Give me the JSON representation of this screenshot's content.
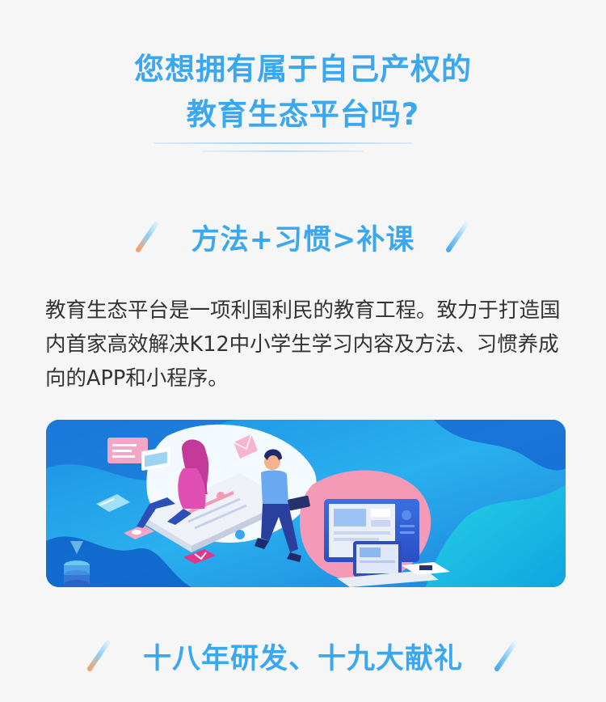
{
  "hero": {
    "title_line1": "您想拥有属于自己产权的",
    "title_line2": "教育生态平台吗?"
  },
  "section1": {
    "heading": "方法+习惯>补课",
    "description": "教育生态平台是一项利国利民的教育工程。致力于打造国内首家高效解决K12中小学生学习内容及方法、习惯养成向的APP和小程序。"
  },
  "section2": {
    "heading": "十八年研发、十九大献礼"
  },
  "colors": {
    "accent_blue": "#3aa7ee",
    "text": "#333333",
    "background": "#f6f6f7",
    "slash_orange": "#f6a36a"
  },
  "icons": {
    "heading_decoration": "diagonal-slash-icon"
  }
}
